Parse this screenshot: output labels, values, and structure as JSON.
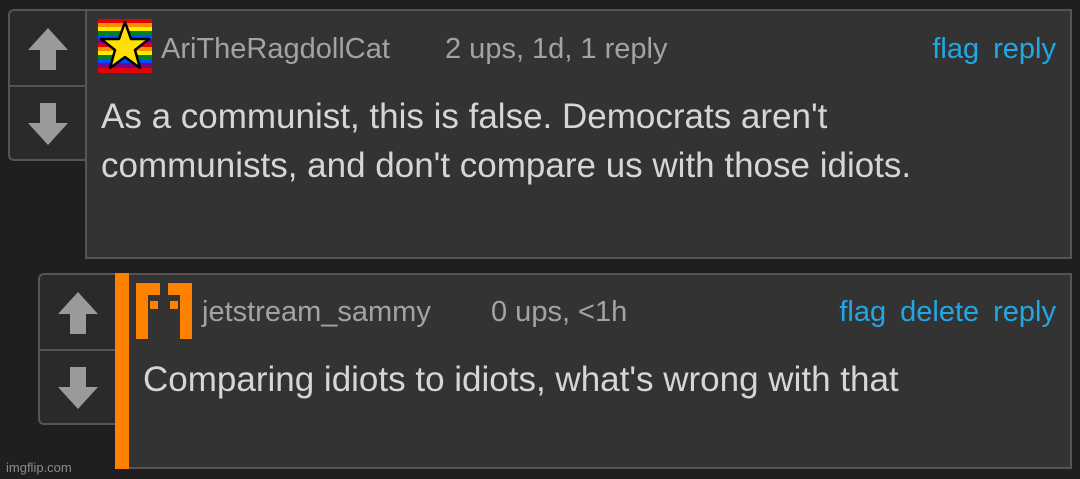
{
  "colors": {
    "background": "#1f1f1f",
    "panel": "#333333",
    "border": "#555555",
    "link": "#21a7e4",
    "muted_text": "#a3a3a3",
    "body_text": "#d6d6d6",
    "reply_accent": "#ff8100",
    "arrow": "#9a9a9a"
  },
  "comments": [
    {
      "username": "AriTheRagdollCat",
      "meta": "2 ups, 1d, 1 reply",
      "actions": [
        "flag",
        "reply"
      ],
      "text": "As a communist, this is false. Democrats aren't communists, and don't compare us with those idiots.",
      "avatar_icon": "rainbow-star-icon"
    },
    {
      "username": "jetstream_sammy",
      "meta": "0 ups, <1h",
      "actions": [
        "flag",
        "delete",
        "reply"
      ],
      "text": "Comparing idiots to idiots, what's wrong with that",
      "avatar_icon": "orange-bracket-icon"
    }
  ],
  "watermark": "imgflip.com"
}
